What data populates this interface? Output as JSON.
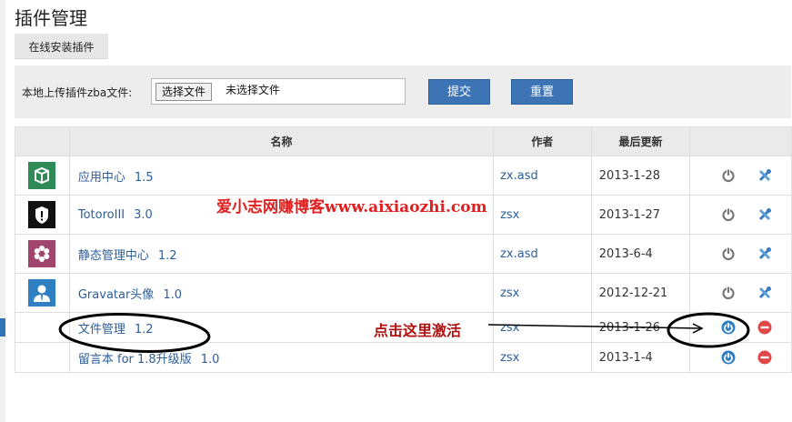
{
  "page": {
    "title": "插件管理"
  },
  "online_install": {
    "label": "在线安装插件"
  },
  "upload": {
    "label": "本地上传插件zba文件:",
    "file_button": "选择文件",
    "file_status": "未选择文件",
    "submit": "提交",
    "reset": "重置"
  },
  "table": {
    "headers": {
      "name": "名称",
      "author": "作者",
      "updated": "最后更新"
    },
    "rows": [
      {
        "name": "应用中心",
        "version": "1.5",
        "author": "zx.asd",
        "date": "2013-1-28",
        "icon": "app-center-icon",
        "icon_color": "#2e8b57",
        "state": "active"
      },
      {
        "name": "TotoroIII",
        "version": "3.0",
        "author": "zsx",
        "date": "2013-1-27",
        "icon": "shield-icon",
        "icon_color": "#111111",
        "state": "active"
      },
      {
        "name": "静态管理中心",
        "version": "1.2",
        "author": "zx.asd",
        "date": "2013-6-4",
        "icon": "flower-icon",
        "icon_color": "#a0456e",
        "state": "active"
      },
      {
        "name": "Gravatar头像",
        "version": "1.0",
        "author": "zsx",
        "date": "2012-12-21",
        "icon": "avatar-icon",
        "icon_color": "#2f80c2",
        "state": "active"
      },
      {
        "name": "文件管理",
        "version": "1.2",
        "author": "zsx",
        "date": "2013-1-26",
        "icon": "",
        "icon_color": "",
        "state": "inactive"
      },
      {
        "name": "留言本 for 1.8升级版",
        "version": "1.0",
        "author": "zsx",
        "date": "2013-1-4",
        "icon": "",
        "icon_color": "",
        "state": "inactive"
      }
    ]
  },
  "overlay": {
    "watermark": "爱小志网赚博客www.aixiaozhi.com",
    "annotation": "点击这里激活",
    "color": "#e02020"
  }
}
